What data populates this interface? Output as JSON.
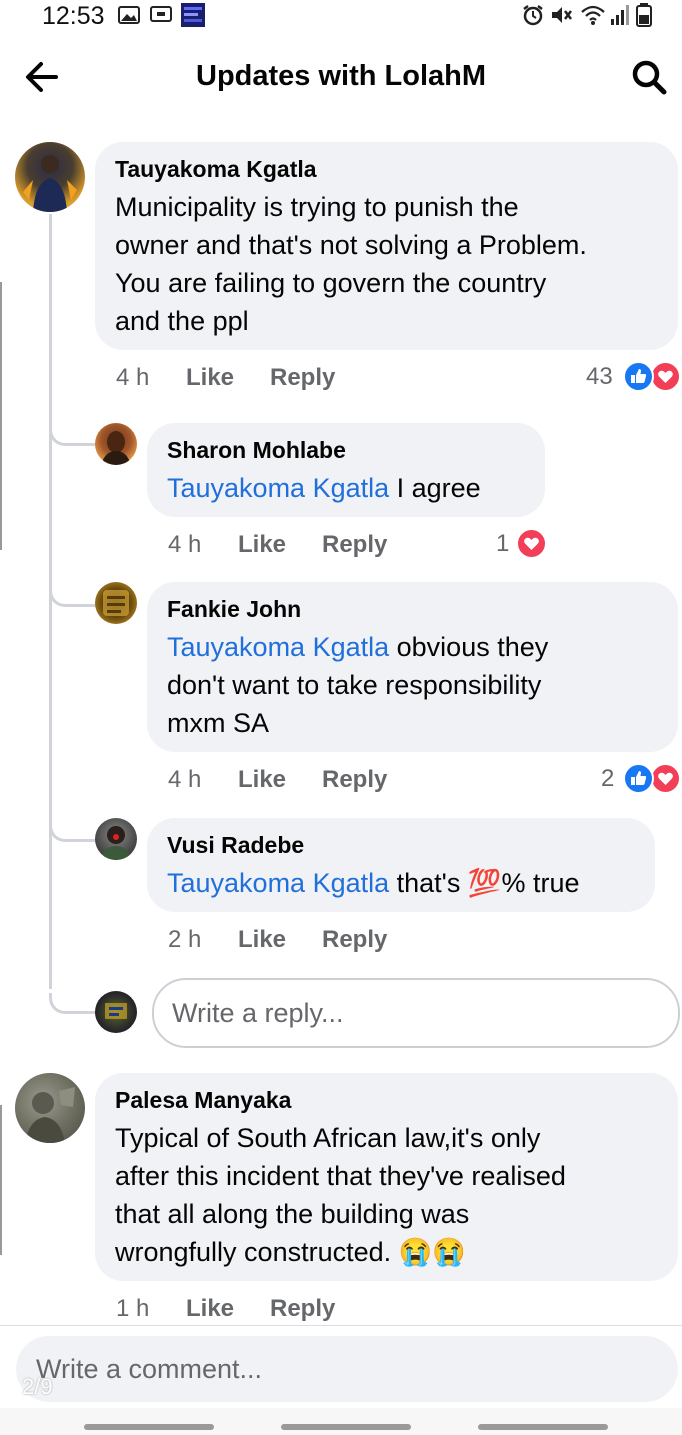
{
  "status_bar": {
    "time": "12:53",
    "left_icons": [
      "image-icon",
      "cast-icon",
      "app-thumbnail-icon"
    ],
    "right_icons": [
      "alarm-icon",
      "mute-icon",
      "wifi-icon",
      "signal-icon",
      "battery-icon"
    ]
  },
  "header": {
    "title": "Updates with LolahM"
  },
  "comments": [
    {
      "author": "Tauyakoma Kgatla",
      "lines": [
        "Municipality is trying to punish the",
        "owner and that's not solving a Problem.",
        "You are failing to govern the country",
        "and the ppl"
      ],
      "time": "4 h",
      "like_label": "Like",
      "reply_label": "Reply",
      "reaction_count": "43",
      "reactions": [
        "like",
        "love"
      ]
    },
    {
      "author": "Palesa Manyaka",
      "lines": [
        "Typical of South African law,it's only",
        "after this incident that they've realised",
        "that all along the building was",
        "wrongfully constructed. 😭😭"
      ],
      "time": "1 h",
      "like_label": "Like",
      "reply_label": "Reply"
    }
  ],
  "replies": [
    {
      "author": "Sharon Mohlabe",
      "mention": "Tauyakoma Kgatla",
      "lines": [
        " I agree"
      ],
      "time": "4 h",
      "like_label": "Like",
      "reply_label": "Reply",
      "reaction_count": "1",
      "reactions": [
        "love"
      ]
    },
    {
      "author": "Fankie John",
      "mention": "Tauyakoma Kgatla",
      "lines": [
        " obvious they",
        "don't want to take responsibility",
        "mxm SA"
      ],
      "time": "4 h",
      "like_label": "Like",
      "reply_label": "Reply",
      "reaction_count": "2",
      "reactions": [
        "like",
        "love"
      ]
    },
    {
      "author": "Vusi Radebe",
      "mention": "Tauyakoma Kgatla",
      "lines": [
        " that's 💯% true"
      ],
      "time": "2 h",
      "like_label": "Like",
      "reply_label": "Reply"
    }
  ],
  "reply_input": {
    "placeholder": "Write a reply..."
  },
  "comment_input": {
    "placeholder": "Write a comment..."
  },
  "page_indicator": "2/9",
  "colors": {
    "mention": "#216fdb",
    "bubble": "#f0f2f5",
    "like": "#1877f2",
    "love": "#f33e58",
    "meta": "#65676b"
  }
}
